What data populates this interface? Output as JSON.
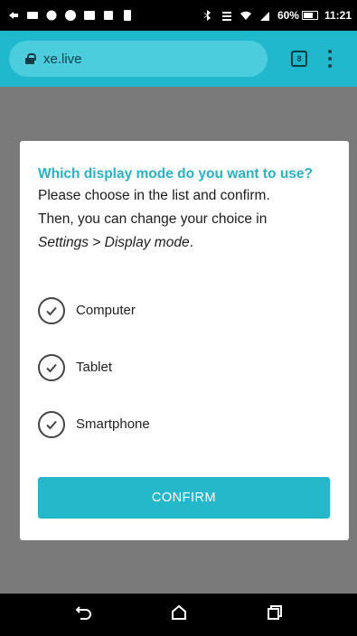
{
  "status_bar": {
    "battery_text": "60%",
    "time": "11:21"
  },
  "browser": {
    "url": "xe.live",
    "tab_count": "8"
  },
  "dialog": {
    "title": "Which display mode do you want to use?",
    "line1": "Please choose in the list and confirm.",
    "line2": "Then, you can change your choice in",
    "line3_path": "Settings > Display mode",
    "line3_end": ".",
    "options": [
      {
        "label": "Computer"
      },
      {
        "label": "Tablet"
      },
      {
        "label": "Smartphone"
      }
    ],
    "confirm_label": "CONFIRM"
  },
  "colors": {
    "accent": "#25b8cb",
    "address_bar": "#1fb8cc",
    "page_backdrop": "#7a7a7a"
  }
}
